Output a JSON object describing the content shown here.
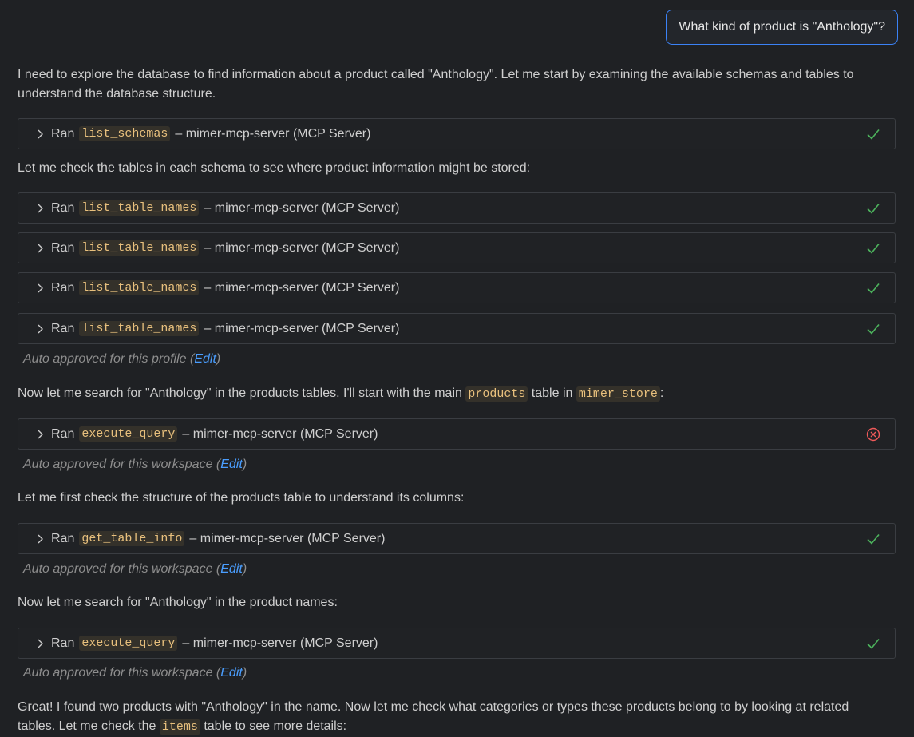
{
  "user_message": "What kind of product is \"Anthology\"?",
  "msg1": "I need to explore the database to find information about a product called \"Anthology\". Let me start by examining the available schemas and tables to understand the database structure.",
  "msg2": "Let me check the tables in each schema to see where product information might be stored:",
  "msg3": {
    "prefix": "Now let me search for \"Anthology\" in the products tables. I'll start with the main ",
    "code1": "products",
    "middle": " table in ",
    "code2": "mimer_store",
    "suffix": ":"
  },
  "msg4": "Let me first check the structure of the products table to understand its columns:",
  "msg5": "Now let me search for \"Anthology\" in the product names:",
  "msg6": {
    "line1": "Great! I found two products with \"Anthology\" in the name. Now let me check what categories or types these products belong to by looking at related",
    "prefix2": "tables. Let me check the ",
    "code": "items",
    "suffix2": " table to see more details:"
  },
  "tool_calls": [
    {
      "ran": "Ran",
      "tool": "list_schemas",
      "server": "– mimer-mcp-server (MCP Server)",
      "status": "success"
    },
    {
      "ran": "Ran",
      "tool": "list_table_names",
      "server": "– mimer-mcp-server (MCP Server)",
      "status": "success"
    },
    {
      "ran": "Ran",
      "tool": "list_table_names",
      "server": "– mimer-mcp-server (MCP Server)",
      "status": "success"
    },
    {
      "ran": "Ran",
      "tool": "list_table_names",
      "server": "– mimer-mcp-server (MCP Server)",
      "status": "success"
    },
    {
      "ran": "Ran",
      "tool": "list_table_names",
      "server": "– mimer-mcp-server (MCP Server)",
      "status": "success"
    },
    {
      "ran": "Ran",
      "tool": "execute_query",
      "server": "– mimer-mcp-server (MCP Server)",
      "status": "error"
    },
    {
      "ran": "Ran",
      "tool": "get_table_info",
      "server": "– mimer-mcp-server (MCP Server)",
      "status": "success"
    },
    {
      "ran": "Ran",
      "tool": "execute_query",
      "server": "– mimer-mcp-server (MCP Server)",
      "status": "success"
    }
  ],
  "approvals": [
    {
      "text": "Auto approved for this profile (",
      "link": "Edit",
      "close": ")"
    },
    {
      "text": "Auto approved for this workspace (",
      "link": "Edit",
      "close": ")"
    },
    {
      "text": "Auto approved for this workspace (",
      "link": "Edit",
      "close": ")"
    },
    {
      "text": "Auto approved for this workspace (",
      "link": "Edit",
      "close": ")"
    }
  ],
  "colors": {
    "success": "#4cb25c",
    "error": "#f05a5a",
    "link": "#4a9eff",
    "accent": "#3b82f6"
  },
  "icons": {
    "chevron": "chevron-right-icon",
    "success": "check-icon",
    "error": "error-circle-icon"
  }
}
